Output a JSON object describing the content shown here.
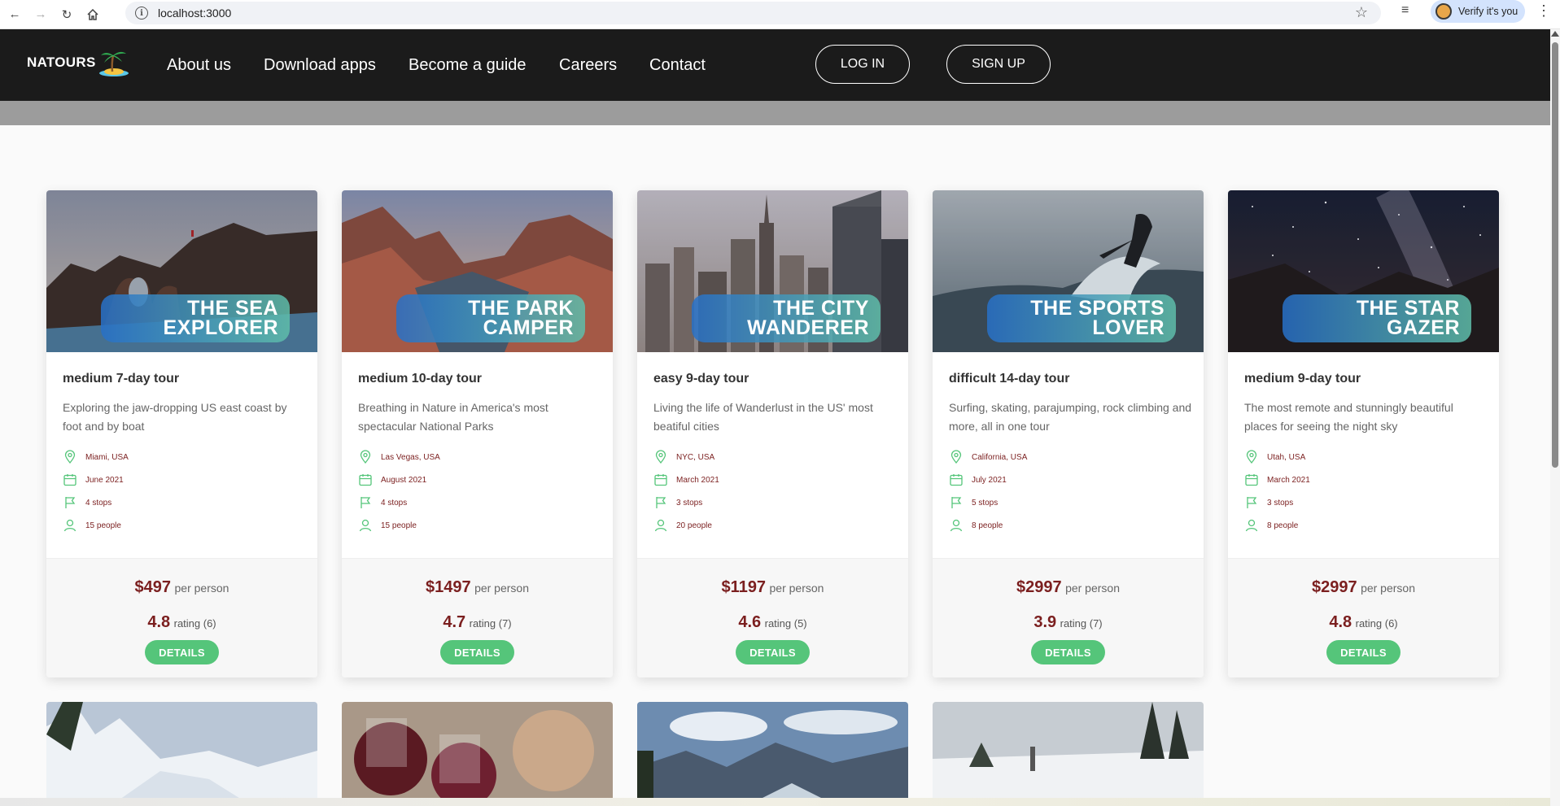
{
  "browser": {
    "url": "localhost:3000",
    "profile_label": "Verify it's you"
  },
  "header": {
    "logo": "NATOURS",
    "nav": [
      "About us",
      "Download apps",
      "Become a guide",
      "Careers",
      "Contact"
    ],
    "login_label": "LOG IN",
    "signup_label": "SIGN UP"
  },
  "colors": {
    "header_bg": "#1b1b1b",
    "accent_green": "#55c57a",
    "price_red": "#7b1f1f"
  },
  "tours": [
    {
      "title_line1": "THE SEA",
      "title_line2": "EXPLORER",
      "subtitle": "medium 7-day tour",
      "description": "Exploring the jaw-dropping US east coast by foot and by boat",
      "location": "Miami, USA",
      "date": "June 2021",
      "stops": "4 stops",
      "people": "15 people",
      "price": "$497",
      "per": "per person",
      "rating": "4.8",
      "rating_label": "rating (6)",
      "details_label": "DETAILS"
    },
    {
      "title_line1": "THE PARK",
      "title_line2": "CAMPER",
      "subtitle": "medium 10-day tour",
      "description": "Breathing in Nature in America's most spectacular National Parks",
      "location": "Las Vegas, USA",
      "date": "August 2021",
      "stops": "4 stops",
      "people": "15 people",
      "price": "$1497",
      "per": "per person",
      "rating": "4.7",
      "rating_label": "rating (7)",
      "details_label": "DETAILS"
    },
    {
      "title_line1": "THE CITY",
      "title_line2": "WANDERER",
      "subtitle": "easy 9-day tour",
      "description": "Living the life of Wanderlust in the US' most beatiful cities",
      "location": "NYC, USA",
      "date": "March 2021",
      "stops": "3 stops",
      "people": "20 people",
      "price": "$1197",
      "per": "per person",
      "rating": "4.6",
      "rating_label": "rating (5)",
      "details_label": "DETAILS"
    },
    {
      "title_line1": "THE SPORTS",
      "title_line2": "LOVER",
      "subtitle": "difficult 14-day tour",
      "description": "Surfing, skating, parajumping, rock climbing and more, all in one tour",
      "location": "California, USA",
      "date": "July 2021",
      "stops": "5 stops",
      "people": "8 people",
      "price": "$2997",
      "per": "per person",
      "rating": "3.9",
      "rating_label": "rating (7)",
      "details_label": "DETAILS"
    },
    {
      "title_line1": "THE STAR",
      "title_line2": "GAZER",
      "subtitle": "medium 9-day tour",
      "description": "The most remote and stunningly beautiful places for seeing the night sky",
      "location": "Utah, USA",
      "date": "March 2021",
      "stops": "3 stops",
      "people": "8 people",
      "price": "$2997",
      "per": "per person",
      "rating": "4.8",
      "rating_label": "rating (6)",
      "details_label": "DETAILS"
    }
  ]
}
